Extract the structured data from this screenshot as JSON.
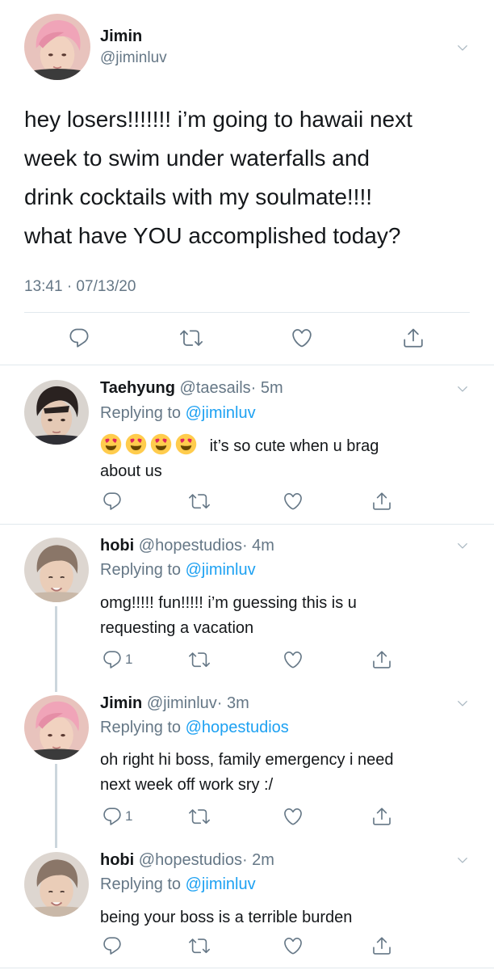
{
  "main": {
    "name": "Jimin",
    "handle": "@jiminluv",
    "text_lines": [
      "hey losers!!!!!!! i’m going to hawaii next",
      "week to swim under waterfalls and",
      "drink cocktails with my soulmate!!!!",
      "what have YOU accomplished today?"
    ],
    "timestamp": "13:41 · 07/13/20"
  },
  "replies": [
    {
      "name": "Taehyung",
      "handle": "@taesails",
      "time": "· 5m",
      "replying_prefix": "Replying to ",
      "replying_to": "@jiminluv",
      "emojis": [
        "smiling-face-with-heart-eyes",
        "smiling-face-with-heart-eyes",
        "smiling-face-with-heart-eyes",
        "smiling-face-with-heart-eyes"
      ],
      "line1": "it’s so cute when u brag",
      "line2": "about us",
      "reply_count": ""
    },
    {
      "name": "hobi",
      "handle": "@hopestudios",
      "time": "· 4m",
      "replying_prefix": "Replying to ",
      "replying_to": "@jiminluv",
      "line1": "omg!!!!! fun!!!!! i’m guessing this is u",
      "line2": "requesting a vacation",
      "reply_count": "1"
    },
    {
      "name": "Jimin",
      "handle": "@jiminluv",
      "time": "· 3m",
      "replying_prefix": "Replying to ",
      "replying_to": "@hopestudios",
      "line1": "oh right hi boss, family emergency i need",
      "line2": "next week off work sry :/",
      "reply_count": "1"
    },
    {
      "name": "hobi",
      "handle": "@hopestudios",
      "time": "· 2m",
      "replying_prefix": "Replying to ",
      "replying_to": "@jiminluv",
      "line1": "being your boss is a terrible burden",
      "reply_count": ""
    }
  ],
  "icons": {
    "reply": "speech-bubble-icon",
    "retweet": "retweet-icon",
    "like": "heart-icon",
    "share": "share-icon",
    "more": "chevron-down-icon"
  },
  "colors": {
    "link": "#1da1f2",
    "muted": "#657786",
    "divider": "#e1e8ed",
    "thread_line": "#ccd6dd"
  }
}
